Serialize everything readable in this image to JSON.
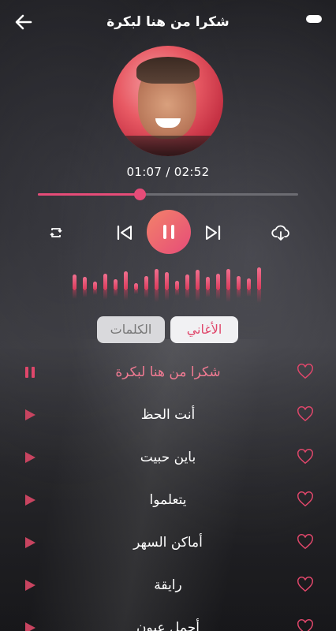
{
  "header": {
    "title": "شكرا من هنا لبكرة",
    "back_icon": "arrow-left-icon",
    "menu_icon": "menu-pill-icon"
  },
  "player": {
    "current_time": "01:07",
    "total_time": "02:52",
    "time_text": "01:07 / 02:52",
    "progress": 0.39,
    "accent": "#e64c78",
    "controls": {
      "repeat_icon": "repeat-icon",
      "prev_icon": "skip-previous-icon",
      "play_pause_icon": "pause-icon",
      "next_icon": "skip-next-icon",
      "download_icon": "cloud-download-icon"
    }
  },
  "equalizer": {
    "levels": [
      0.65,
      0.55,
      0.35,
      0.7,
      0.45,
      0.8,
      0.3,
      0.6,
      0.9,
      0.75,
      0.4,
      0.65,
      0.85,
      0.55,
      0.7,
      0.9,
      0.6,
      0.5,
      0.95
    ]
  },
  "tabs": [
    {
      "label": "الأغاني",
      "active": true
    },
    {
      "label": "الكلمات",
      "active": false
    }
  ],
  "songs": [
    {
      "title": "شكرا من هنا لبكرة",
      "playing": true
    },
    {
      "title": "أنت الحظ",
      "playing": false
    },
    {
      "title": "باين حبيت",
      "playing": false
    },
    {
      "title": "يتعلموا",
      "playing": false
    },
    {
      "title": "أماكن السهر",
      "playing": false
    },
    {
      "title": "رايقة",
      "playing": false
    },
    {
      "title": "أجمل عيون",
      "playing": false
    }
  ],
  "colors": {
    "accent": "#e64c78",
    "playing_text": "#f07a92",
    "list_icon": "#d64a6a"
  }
}
